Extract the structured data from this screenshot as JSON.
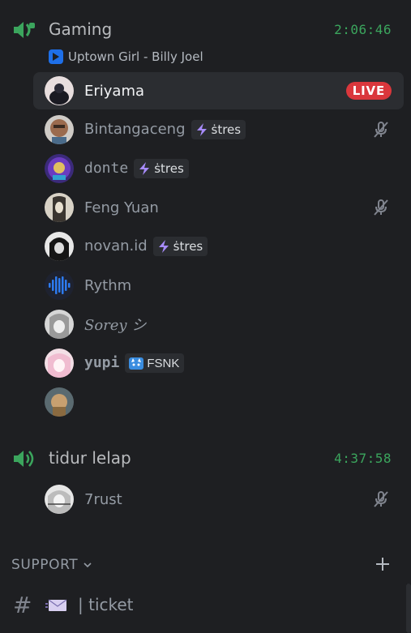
{
  "channels": [
    {
      "name": "Gaming",
      "timer": "2:06:46",
      "activity": {
        "text": "Uptown Girl - Billy Joel",
        "icon": "play-icon"
      },
      "users": [
        {
          "name": "Eriyama",
          "live": "LIVE",
          "active": true
        },
        {
          "name": "Bintangaceng",
          "tag": "ṡtres",
          "muted": true
        },
        {
          "name": "donte",
          "tag": "ṡtres"
        },
        {
          "name": "Feng Yuan",
          "muted": true
        },
        {
          "name": "novan.id",
          "tag": "ṡtres"
        },
        {
          "name": "Rythm"
        },
        {
          "name": "Sorey シ"
        },
        {
          "name": "yupi",
          "tag": "FSNK"
        },
        {
          "name": ""
        }
      ]
    },
    {
      "name": "tidur lelap",
      "timer": "4:37:58",
      "users": [
        {
          "name": "7rust",
          "muted": true
        }
      ]
    }
  ],
  "category": {
    "label": "SUPPORT"
  },
  "text_channel": {
    "label": "| ticket"
  },
  "colors": {
    "background": "#1e1f22",
    "timer_green": "#3ba55d",
    "live_red": "#da373c",
    "speaker_green": "#3ba55d",
    "tag_bolt": "#a78bfa"
  }
}
